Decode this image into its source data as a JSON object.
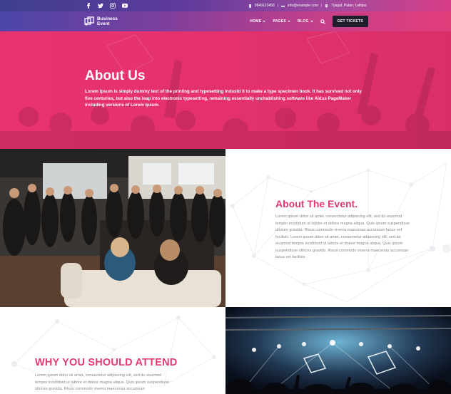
{
  "topbar": {
    "social": [
      "facebook-icon",
      "twitter-icon",
      "instagram-icon",
      "youtube-icon"
    ],
    "phone": "9849123456",
    "email": "info@example.com",
    "address": "Tyagal, Patan, Lalitpur",
    "separator": "|"
  },
  "navbar": {
    "logo_line1": "Business",
    "logo_line2": "Event",
    "menu": [
      {
        "label": "HOME",
        "dropdown": true
      },
      {
        "label": "PAGES",
        "dropdown": true
      },
      {
        "label": "BLOG",
        "dropdown": true
      }
    ],
    "cta": "GET TICKETS"
  },
  "hero": {
    "title": "About Us",
    "description": "Lorem Ipsum is simply dummy text of the printing and typesetting industd it to make a type specimen book. It has survived not only five centuries, but also the leap into electronic typesetting, remaining essentially unchablishing software like Aldus PageMaker including versions of Lorem Ipsum."
  },
  "about_event": {
    "title": "About The Event.",
    "text": "Lorem ipsum dolor sit amet, consectetur adipiscing elit, sed do eiusmod tempor incididunt ut labore et dolore magna aliqua. Quis ipsum suspendisse ultrices gravida. Risus commodo viverra maecenas accumsan lacus vel facilisis. Lorem ipsum dolor sit amet, consectetur adipiscing elit, sed do eiusmod tempor incididunt ut labore et dolore magna aliqua. Quis ipsum suspendisse ultrices gravida. Risus commodo viverra maecenas accumsan lacus vel facilisis."
  },
  "why_attend": {
    "title": "WHY YOU SHOULD ATTEND",
    "text": "Lorem ipsum dolor sit amet, consectetur adipiscing elit, sed do eiusmod tempor incididunt ut labore et dolore magna aliqua. Quis ipsum suspendisse ultrices gravida. Risus commodo viverra maecenas accumsan"
  },
  "colors": {
    "accent": "#e23a74",
    "hero_bg": "#e4316e",
    "ticket_btn": "#1d1d2b"
  }
}
